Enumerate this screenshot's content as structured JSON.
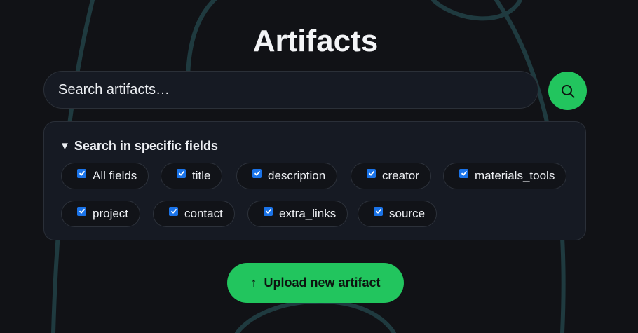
{
  "header": {
    "title": "Artifacts"
  },
  "search": {
    "placeholder": "Search artifacts…",
    "button_icon": "search-icon"
  },
  "fields": {
    "summary": "Search in specific fields",
    "summary_icon": "triangle-down-icon",
    "options": [
      {
        "label": "All fields",
        "checked": true
      },
      {
        "label": "title",
        "checked": true
      },
      {
        "label": "description",
        "checked": true
      },
      {
        "label": "creator",
        "checked": true
      },
      {
        "label": "materials_tools",
        "checked": true
      },
      {
        "label": "project",
        "checked": true
      },
      {
        "label": "contact",
        "checked": true
      },
      {
        "label": "extra_links",
        "checked": true
      },
      {
        "label": "source",
        "checked": true
      }
    ]
  },
  "upload": {
    "icon": "↑",
    "label": "Upload new artifact"
  },
  "colors": {
    "background": "#111216",
    "accent": "#22c55e",
    "checkbox": "#1a73e8",
    "decorative_lines": "#1f3a3f"
  }
}
